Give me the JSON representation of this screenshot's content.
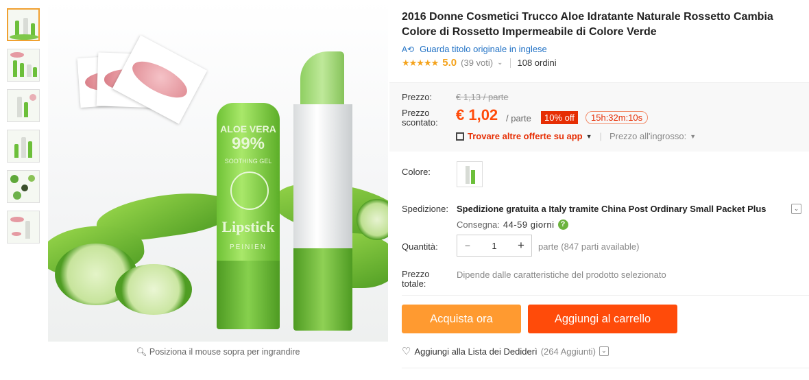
{
  "gallery": {
    "zoom_hint": "Posiziona il mouse sopra per ingrandire",
    "thumb_count": 6
  },
  "product": {
    "title": "2016 Donne Cosmetici Trucco Aloe Idratante Naturale Rossetto Cambia Colore di Rossetto Impermeabile di Colore Verde",
    "original_title_link": "Guarda titolo originale in inglese",
    "rating": {
      "stars": "★★★★★",
      "score": "5.0",
      "votes": "(39 voti)",
      "orders": "108 ordini"
    }
  },
  "price": {
    "label_price": "Prezzo:",
    "old_price": "€ 1,13 / parte",
    "label_discount_1": "Prezzo",
    "label_discount_2": "scontato:",
    "current_price": "€ 1,02",
    "unit": "/ parte",
    "discount_badge": "10% off",
    "countdown": "15h:32m:10s",
    "app_offer": "Trovare altre offerte su app",
    "wholesale": "Prezzo all'ingrosso:"
  },
  "options": {
    "color_label": "Colore:",
    "shipping_label": "Spedizione:",
    "shipping_value": "Spedizione gratuita a Italy tramite China Post Ordinary Small Packet Plus",
    "delivery_label": "Consegna:",
    "delivery_value": "44-59 giorni",
    "qty_label": "Quantità:",
    "qty_value": "1",
    "qty_minus": "−",
    "qty_plus": "+",
    "qty_available": "parte (847 parti available)",
    "total_label_1": "Prezzo",
    "total_label_2": "totale:",
    "total_value": "Dipende dalle caratteristiche del prodotto selezionato"
  },
  "actions": {
    "buy_now": "Acquista ora",
    "add_to_cart": "Aggiungi al carrello",
    "wishlist": "Aggiungi alla Lista dei Dediderì",
    "wishlist_count": "(264 Aggiunti)"
  },
  "product_image": {
    "brand_text_1": "ALOE VERA",
    "brand_text_2": "99%",
    "brand_text_3": "SOOTHING GEL",
    "brand_text_4": "Lipstick",
    "brand_text_5": "PEINIEN"
  },
  "colors": {
    "accent_orange": "#f4a21a",
    "buy_button": "#ff9a30",
    "cart_button": "#ff4b0a",
    "discount_red": "#e62e04",
    "link_blue": "#2272c5"
  }
}
